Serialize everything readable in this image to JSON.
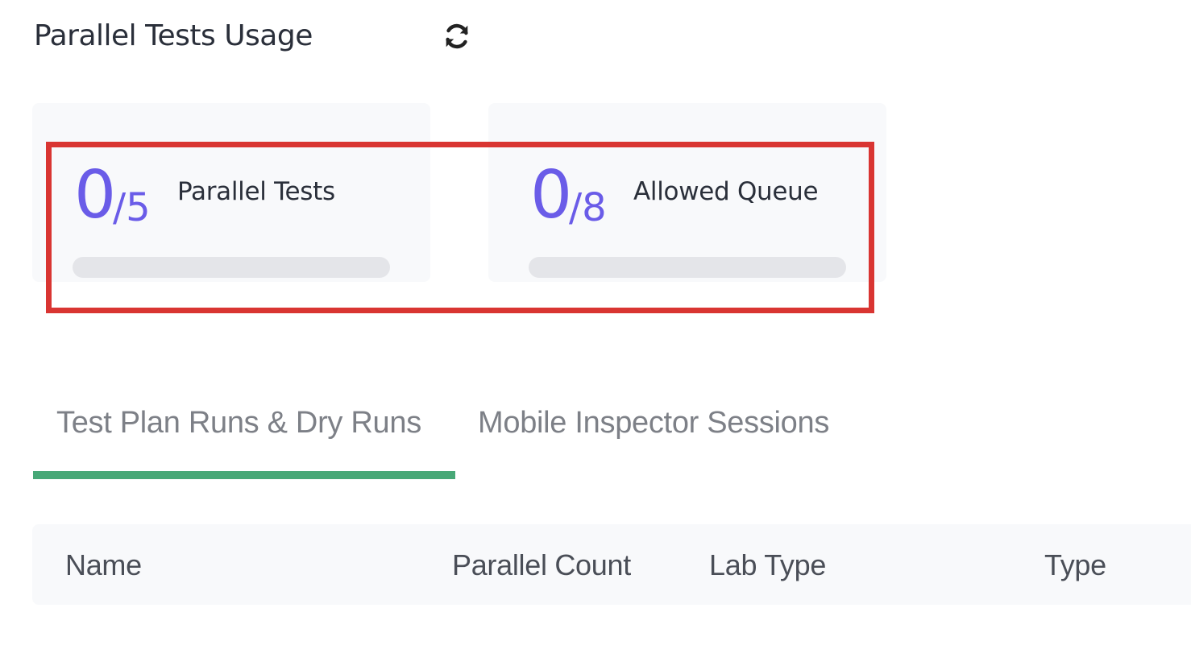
{
  "header": {
    "title": "Parallel Tests Usage",
    "refresh_icon": "refresh-icon"
  },
  "usage": [
    {
      "used": "0",
      "total": "/5",
      "label": "Parallel Tests",
      "fill_fraction": 0
    },
    {
      "used": "0",
      "total": "/8",
      "label": "Allowed Queue",
      "fill_fraction": 0
    }
  ],
  "tabs": [
    {
      "label": "Test Plan Runs & Dry Runs",
      "active": true
    },
    {
      "label": "Mobile Inspector Sessions",
      "active": false
    }
  ],
  "table": {
    "columns": [
      "Name",
      "Parallel Count",
      "Lab Type",
      "Type"
    ]
  },
  "colors": {
    "accent_purple": "#6a5ce8",
    "tab_active_green": "#47a877",
    "highlight_red": "#d93532"
  }
}
